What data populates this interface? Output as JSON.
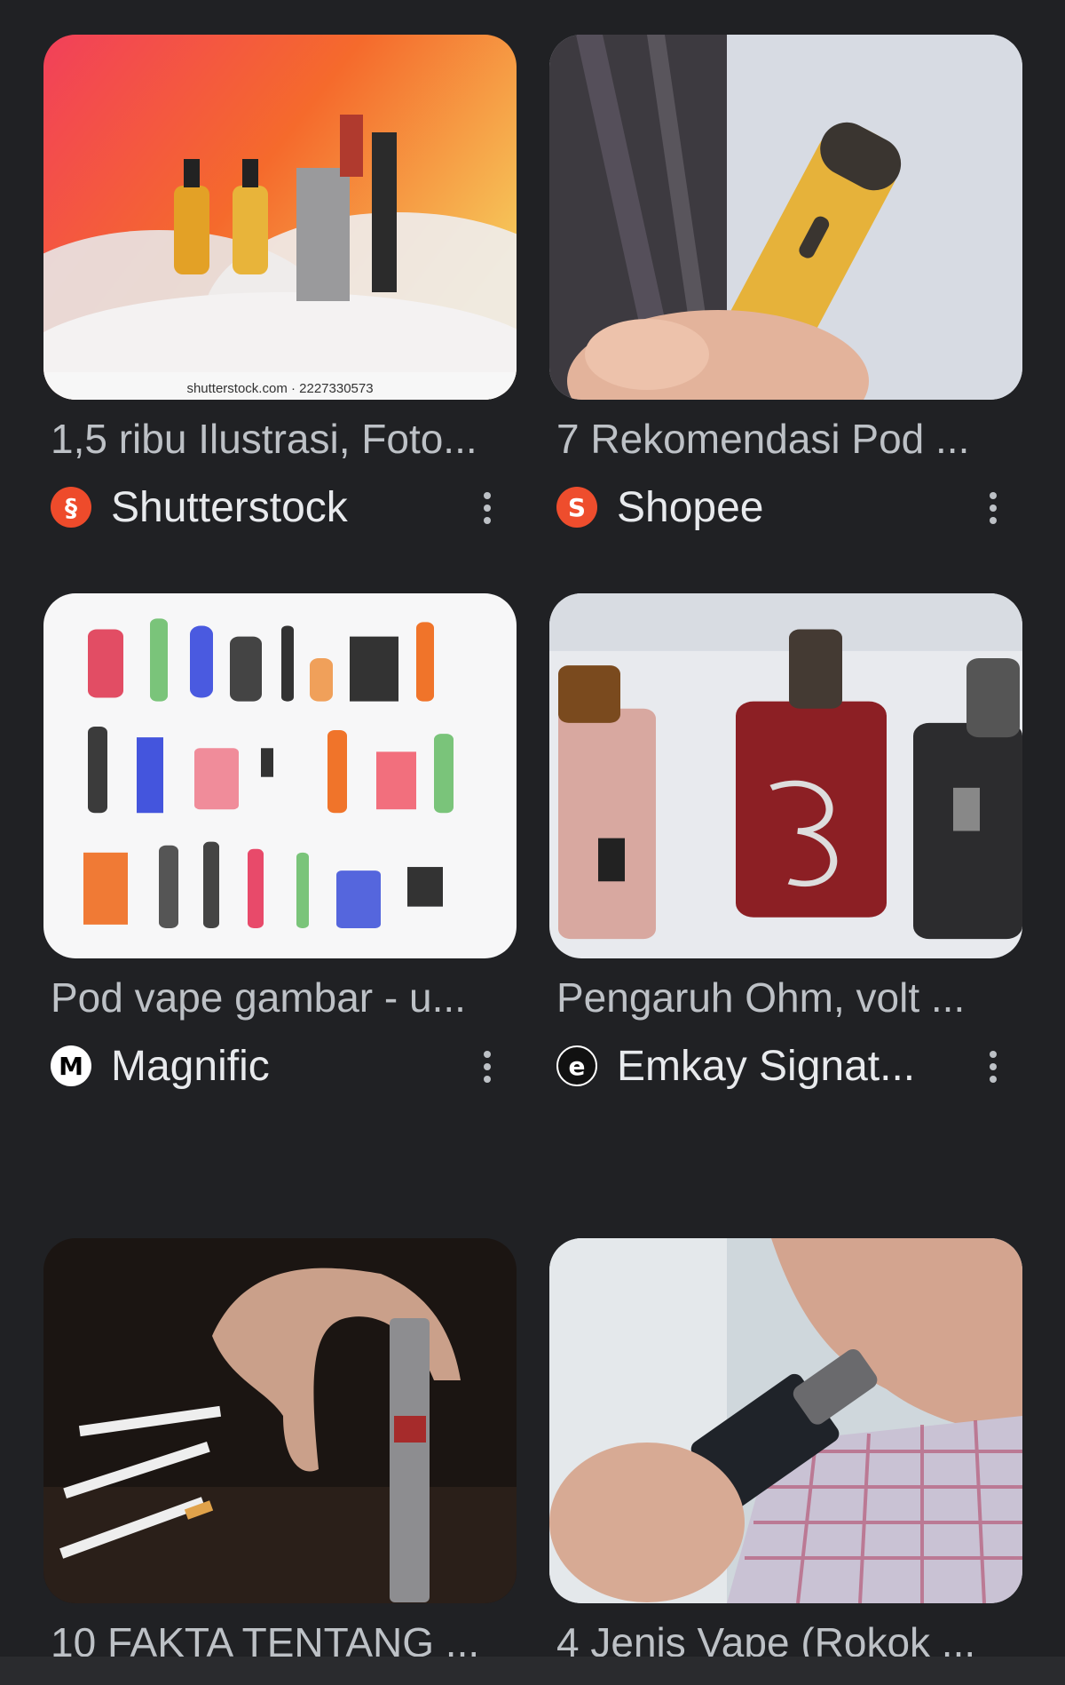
{
  "results": [
    {
      "title": "1,5 ribu Ilustrasi, Foto...",
      "source": "Shutterstock",
      "source_icon": "shutterstock-icon",
      "watermark": "shutterstock.com · 2227330573"
    },
    {
      "title": "7 Rekomendasi Pod ...",
      "source": "Shopee",
      "source_icon": "shopee-icon"
    },
    {
      "title": "Pod vape gambar - u...",
      "source": "Magnific",
      "source_icon": "magnific-icon"
    },
    {
      "title": "Pengaruh Ohm, volt ...",
      "source": "Emkay Signat...",
      "source_icon": "emkay-icon"
    },
    {
      "title": "10 FAKTA TENTANG ...",
      "source": "",
      "source_icon": ""
    },
    {
      "title": "4 Jenis Vape (Rokok ...",
      "source": "",
      "source_icon": ""
    }
  ],
  "colors": {
    "background": "#202124",
    "title": "#bdc1c6",
    "source": "#e8eaed",
    "shutterstock": "#ee4b2b",
    "shopee": "#ee4d2d"
  }
}
